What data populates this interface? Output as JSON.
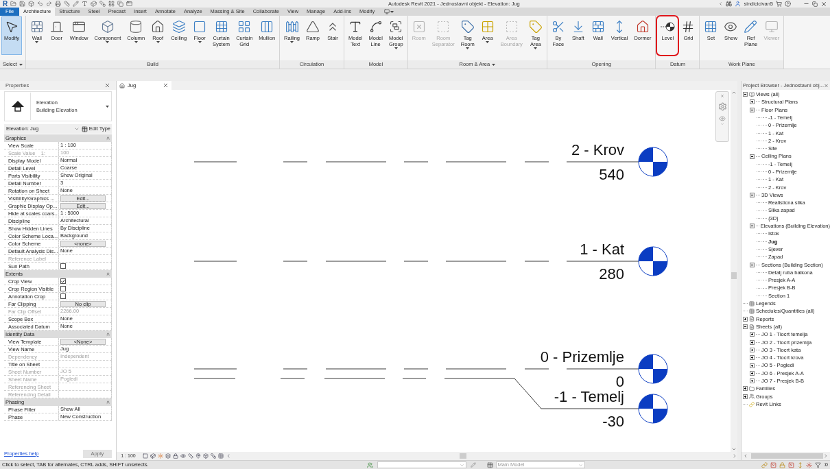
{
  "title_bar": {
    "logo": "R",
    "title": "Autodesk Revit 2021 - Jednostavni objekt - Elevation: Jug",
    "user": "sindicicivan5"
  },
  "tabs": [
    {
      "label": "File",
      "kind": "file",
      "selected": false
    },
    {
      "label": "Architecture",
      "kind": "tab",
      "selected": true
    },
    {
      "label": "Structure",
      "kind": "tab",
      "selected": false
    },
    {
      "label": "Steel",
      "kind": "tab",
      "selected": false
    },
    {
      "label": "Precast",
      "kind": "tab",
      "selected": false
    },
    {
      "label": "Insert",
      "kind": "tab",
      "selected": false
    },
    {
      "label": "Annotate",
      "kind": "tab",
      "selected": false
    },
    {
      "label": "Analyze",
      "kind": "tab",
      "selected": false
    },
    {
      "label": "Massing & Site",
      "kind": "tab",
      "selected": false
    },
    {
      "label": "Collaborate",
      "kind": "tab",
      "selected": false
    },
    {
      "label": "View",
      "kind": "tab",
      "selected": false
    },
    {
      "label": "Manage",
      "kind": "tab",
      "selected": false
    },
    {
      "label": "Add-Ins",
      "kind": "tab",
      "selected": false
    },
    {
      "label": "Modify",
      "kind": "tab",
      "selected": false
    }
  ],
  "ribbon": [
    {
      "title": "Select",
      "dropdown": true,
      "buttons": [
        {
          "label": "Modify",
          "selected": true,
          "disabled": false,
          "caret": false,
          "highlighted": false
        }
      ]
    },
    {
      "title": "Build",
      "dropdown": false,
      "buttons": [
        {
          "label": "Wall",
          "selected": false,
          "disabled": false,
          "caret": true,
          "highlighted": false
        },
        {
          "label": "Door",
          "selected": false,
          "disabled": false,
          "caret": false,
          "highlighted": false
        },
        {
          "label": "Window",
          "selected": false,
          "disabled": false,
          "caret": false,
          "highlighted": false
        },
        {
          "label": "Component",
          "selected": false,
          "disabled": false,
          "caret": true,
          "highlighted": false
        },
        {
          "label": "Column",
          "selected": false,
          "disabled": false,
          "caret": true,
          "highlighted": false
        },
        {
          "label": "Roof",
          "selected": false,
          "disabled": false,
          "caret": true,
          "highlighted": false
        },
        {
          "label": "Ceiling",
          "selected": false,
          "disabled": false,
          "caret": false,
          "highlighted": false
        },
        {
          "label": "Floor",
          "selected": false,
          "disabled": false,
          "caret": true,
          "highlighted": false
        },
        {
          "label": "Curtain\nSystem",
          "selected": false,
          "disabled": false,
          "caret": false,
          "highlighted": false
        },
        {
          "label": "Curtain\nGrid",
          "selected": false,
          "disabled": false,
          "caret": false,
          "highlighted": false
        },
        {
          "label": "Mullion",
          "selected": false,
          "disabled": false,
          "caret": false,
          "highlighted": false
        }
      ]
    },
    {
      "title": "Circulation",
      "dropdown": false,
      "buttons": [
        {
          "label": "Railing",
          "selected": false,
          "disabled": false,
          "caret": true,
          "highlighted": false
        },
        {
          "label": "Ramp",
          "selected": false,
          "disabled": false,
          "caret": false,
          "highlighted": false
        },
        {
          "label": "Stair",
          "selected": false,
          "disabled": false,
          "caret": false,
          "highlighted": false
        }
      ]
    },
    {
      "title": "Model",
      "dropdown": false,
      "buttons": [
        {
          "label": "Model\nText",
          "selected": false,
          "disabled": false,
          "caret": false,
          "highlighted": false
        },
        {
          "label": "Model\nLine",
          "selected": false,
          "disabled": false,
          "caret": false,
          "highlighted": false
        },
        {
          "label": "Model\nGroup",
          "selected": false,
          "disabled": false,
          "caret": true,
          "highlighted": false
        }
      ]
    },
    {
      "title": "Room & Area",
      "dropdown": true,
      "buttons": [
        {
          "label": "Room",
          "selected": false,
          "disabled": true,
          "caret": false,
          "highlighted": false
        },
        {
          "label": "Room\nSeparator",
          "selected": false,
          "disabled": true,
          "caret": false,
          "highlighted": false
        },
        {
          "label": "Tag\nRoom",
          "selected": false,
          "disabled": false,
          "caret": true,
          "highlighted": false
        },
        {
          "label": "Area",
          "selected": false,
          "disabled": false,
          "caret": true,
          "highlighted": false
        },
        {
          "label": "Area\nBoundary",
          "selected": false,
          "disabled": true,
          "caret": false,
          "highlighted": false
        },
        {
          "label": "Tag\nArea",
          "selected": false,
          "disabled": false,
          "caret": true,
          "highlighted": false
        }
      ]
    },
    {
      "title": "Opening",
      "dropdown": false,
      "buttons": [
        {
          "label": "By\nFace",
          "selected": false,
          "disabled": false,
          "caret": false,
          "highlighted": false
        },
        {
          "label": "Shaft",
          "selected": false,
          "disabled": false,
          "caret": false,
          "highlighted": false
        },
        {
          "label": "Wall",
          "selected": false,
          "disabled": false,
          "caret": false,
          "highlighted": false
        },
        {
          "label": "Vertical",
          "selected": false,
          "disabled": false,
          "caret": false,
          "highlighted": false
        },
        {
          "label": "Dormer",
          "selected": false,
          "disabled": false,
          "caret": false,
          "highlighted": false
        }
      ]
    },
    {
      "title": "Datum",
      "dropdown": false,
      "buttons": [
        {
          "label": "Level",
          "selected": false,
          "disabled": false,
          "caret": false,
          "highlighted": true
        },
        {
          "label": "Grid",
          "selected": false,
          "disabled": false,
          "caret": false,
          "highlighted": false
        }
      ]
    },
    {
      "title": "Work Plane",
      "dropdown": false,
      "buttons": [
        {
          "label": "Set",
          "selected": false,
          "disabled": false,
          "caret": false,
          "highlighted": false
        },
        {
          "label": "Show",
          "selected": false,
          "disabled": false,
          "caret": false,
          "highlighted": false
        },
        {
          "label": "Ref\nPlane",
          "selected": false,
          "disabled": false,
          "caret": false,
          "highlighted": false
        },
        {
          "label": "Viewer",
          "selected": false,
          "disabled": true,
          "caret": false,
          "highlighted": false
        }
      ]
    }
  ],
  "properties": {
    "title": "Properties",
    "type_name": "Elevation",
    "type_subname": "Building Elevation",
    "instance": "Elevation: Jug",
    "edit_type": "Edit Type",
    "sections": [
      {
        "title": "Graphics",
        "expanded": true,
        "rows": [
          {
            "name": "View Scale",
            "kind": "text",
            "value": "1 : 100",
            "disabled": false
          },
          {
            "name": "Scale Value    1:",
            "kind": "text",
            "value": "100",
            "disabled": true
          },
          {
            "name": "Display Model",
            "kind": "text",
            "value": "Normal",
            "disabled": false
          },
          {
            "name": "Detail Level",
            "kind": "text",
            "value": "Coarse",
            "disabled": false
          },
          {
            "name": "Parts Visibility",
            "kind": "text",
            "value": "Show Original",
            "disabled": false
          },
          {
            "name": "Detail Number",
            "kind": "text",
            "value": "3",
            "disabled": false
          },
          {
            "name": "Rotation on Sheet",
            "kind": "text",
            "value": "None",
            "disabled": false
          },
          {
            "name": "Visibility/Graphics ...",
            "kind": "button",
            "value": "Edit...",
            "disabled": false
          },
          {
            "name": "Graphic Display Op...",
            "kind": "button",
            "value": "Edit...",
            "disabled": false
          },
          {
            "name": "Hide at scales coars...",
            "kind": "text",
            "value": "1 : 5000",
            "disabled": false
          },
          {
            "name": "Discipline",
            "kind": "text",
            "value": "Architectural",
            "disabled": false
          },
          {
            "name": "Show Hidden Lines",
            "kind": "text",
            "value": "By Discipline",
            "disabled": false
          },
          {
            "name": "Color Scheme Loca...",
            "kind": "text",
            "value": "Background",
            "disabled": false
          },
          {
            "name": "Color Scheme",
            "kind": "button",
            "value": "<none>",
            "disabled": false
          },
          {
            "name": "Default Analysis Dis...",
            "kind": "text",
            "value": "None",
            "disabled": false
          },
          {
            "name": "Reference Label",
            "kind": "text",
            "disabled": true
          },
          {
            "name": "Sun Path",
            "kind": "checkbox",
            "checked": false,
            "disabled": false
          }
        ]
      },
      {
        "title": "Extents",
        "expanded": true,
        "rows": [
          {
            "name": "Crop View",
            "kind": "checkbox",
            "checked": true,
            "disabled": false
          },
          {
            "name": "Crop Region Visible",
            "kind": "checkbox",
            "checked": false,
            "disabled": false
          },
          {
            "name": "Annotation Crop",
            "kind": "checkbox",
            "checked": false,
            "disabled": false
          },
          {
            "name": "Far Clipping",
            "kind": "button",
            "value": "No clip",
            "disabled": false
          },
          {
            "name": "Far Clip Offset",
            "kind": "text",
            "value": "2266.00",
            "disabled": true
          },
          {
            "name": "Scope Box",
            "kind": "text",
            "value": "None",
            "disabled": false
          },
          {
            "name": "Associated Datum",
            "kind": "text",
            "value": "None",
            "disabled": false
          }
        ]
      },
      {
        "title": "Identity Data",
        "expanded": true,
        "rows": [
          {
            "name": "View Template",
            "kind": "button",
            "value": "<None>",
            "disabled": false
          },
          {
            "name": "View Name",
            "kind": "text",
            "value": "Jug",
            "disabled": false
          },
          {
            "name": "Dependency",
            "kind": "text",
            "value": "Independent",
            "disabled": true
          },
          {
            "name": "Title on Sheet",
            "kind": "text",
            "disabled": false
          },
          {
            "name": "Sheet Number",
            "kind": "text",
            "value": "JO 5",
            "disabled": true
          },
          {
            "name": "Sheet Name",
            "kind": "text",
            "value": "Pogledi",
            "disabled": true
          },
          {
            "name": "Referencing Sheet",
            "kind": "text",
            "disabled": true
          },
          {
            "name": "Referencing Detail",
            "kind": "text",
            "disabled": true
          }
        ]
      },
      {
        "title": "Phasing",
        "expanded": true,
        "rows": [
          {
            "name": "Phase Filter",
            "kind": "text",
            "value": "Show All",
            "disabled": false
          },
          {
            "name": "Phase",
            "kind": "text",
            "value": "New Construction",
            "disabled": false
          }
        ]
      }
    ],
    "help": "Properties help",
    "apply": {
      "label": "Apply",
      "disabled": true
    }
  },
  "view": {
    "tab": "Jug",
    "scale": "1 : 100",
    "levels": [
      {
        "name": "2 - Krov",
        "elevation": "540",
        "kind": "straight"
      },
      {
        "name": "1 - Kat",
        "elevation": "280",
        "kind": "straight"
      },
      {
        "name": "0 - Prizemlje",
        "elevation": "0",
        "kind": "straight"
      },
      {
        "name": "-1 - Temelj",
        "elevation": "-30",
        "kind": "elbow"
      }
    ]
  },
  "project_browser": {
    "title": "Project Browser - Jednostavni obj...",
    "items": [
      {
        "label": "Views (all)",
        "selected": false,
        "expanded": true,
        "children": [
          {
            "label": "Structural Plans",
            "selected": false,
            "expanded": false
          },
          {
            "label": "Floor Plans",
            "selected": false,
            "expanded": true,
            "children": [
              {
                "label": "-1 - Temelj",
                "selected": false
              },
              {
                "label": "0 - Prizemlje",
                "selected": false
              },
              {
                "label": "1 - Kat",
                "selected": false
              },
              {
                "label": "2 - Krov",
                "selected": false
              },
              {
                "label": "Site",
                "selected": false
              }
            ]
          },
          {
            "label": "Ceiling Plans",
            "selected": false,
            "expanded": true,
            "children": [
              {
                "label": "-1 - Temelj",
                "selected": false
              },
              {
                "label": "0 - Prizemlje",
                "selected": false
              },
              {
                "label": "1 - Kat",
                "selected": false
              },
              {
                "label": "2 - Krov",
                "selected": false
              }
            ]
          },
          {
            "label": "3D Views",
            "selected": false,
            "expanded": true,
            "children": [
              {
                "label": "Realisticna slika",
                "selected": false
              },
              {
                "label": "Slika zapad",
                "selected": false
              },
              {
                "label": "{3D}",
                "selected": false
              }
            ]
          },
          {
            "label": "Elevations (Building Elevation)",
            "selected": false,
            "expanded": true,
            "children": [
              {
                "label": "Istok",
                "selected": false
              },
              {
                "label": "Jug",
                "selected": true
              },
              {
                "label": "Sjever",
                "selected": false
              },
              {
                "label": "Zapad",
                "selected": false
              }
            ]
          },
          {
            "label": "Sections (Building Section)",
            "selected": false,
            "expanded": true,
            "children": [
              {
                "label": "Detalj ruba balkona",
                "selected": false
              },
              {
                "label": "Presjek A-A",
                "selected": false
              },
              {
                "label": "Presjek B-B",
                "selected": false
              },
              {
                "label": "Section 1",
                "selected": false
              }
            ]
          }
        ]
      },
      {
        "label": "Legends",
        "selected": false
      },
      {
        "label": "Schedules/Quantities (all)",
        "selected": false
      },
      {
        "label": "Reports",
        "selected": false,
        "expanded": false
      },
      {
        "label": "Sheets (all)",
        "selected": false,
        "expanded": true,
        "children": [
          {
            "label": "JO 1 - Tlocrt temelja",
            "selected": false,
            "expanded": false
          },
          {
            "label": "JO 2 - Tlocrt prizemlja",
            "selected": false,
            "expanded": false
          },
          {
            "label": "JO 3 - Tlocrt kata",
            "selected": false,
            "expanded": false
          },
          {
            "label": "JO 4 - Tlocrt krova",
            "selected": false,
            "expanded": false
          },
          {
            "label": "JO 5 - Pogledi",
            "selected": false,
            "expanded": false
          },
          {
            "label": "JO 6 - Presjek A-A",
            "selected": false,
            "expanded": false
          },
          {
            "label": "JO 7 - Presjek B-B",
            "selected": false,
            "expanded": false
          }
        ]
      },
      {
        "label": "Families",
        "selected": false,
        "expanded": false
      },
      {
        "label": "Groups",
        "selected": false,
        "expanded": false
      },
      {
        "label": "Revit Links",
        "selected": false
      }
    ]
  },
  "status_bar": {
    "message": "Click to select, TAB for alternates, CTRL adds, SHIFT unselects.",
    "model": "Main Model",
    "filter_count": ":0"
  }
}
